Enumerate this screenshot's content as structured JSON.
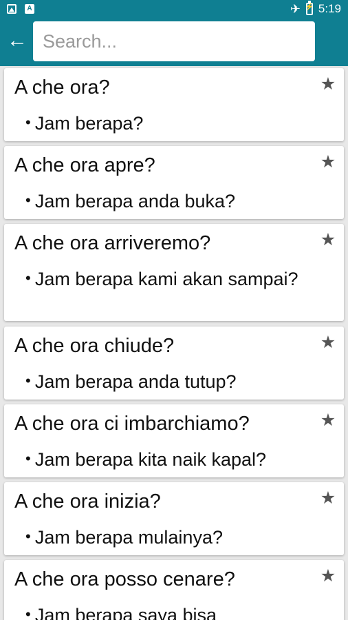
{
  "status_bar": {
    "time": "5:19",
    "left_icons": [
      "image-icon",
      "a-icon"
    ],
    "right_icons": [
      "airplane-icon",
      "battery-charging-icon"
    ]
  },
  "app_bar": {
    "search_placeholder": "Search..."
  },
  "colors": {
    "primary": "#0f7f92",
    "card": "#ffffff",
    "background": "#e8e8e8",
    "star": "#555555"
  },
  "items": [
    {
      "italian": "A che ora?",
      "translation": "Jam berapa?"
    },
    {
      "italian": "A che ora apre?",
      "translation": "Jam berapa anda buka?"
    },
    {
      "italian": "A che ora arriveremo?",
      "translation": "Jam berapa kami akan sampai?"
    },
    {
      "italian": "A che ora chiude?",
      "translation": "Jam berapa anda tutup?"
    },
    {
      "italian": "A che ora ci imbarchiamo?",
      "translation": "Jam berapa kita naik kapal?"
    },
    {
      "italian": "A che ora inizia?",
      "translation": "Jam berapa mulainya?"
    },
    {
      "italian": "A che ora posso cenare?",
      "translation": "Jam berapa saya bisa"
    }
  ]
}
